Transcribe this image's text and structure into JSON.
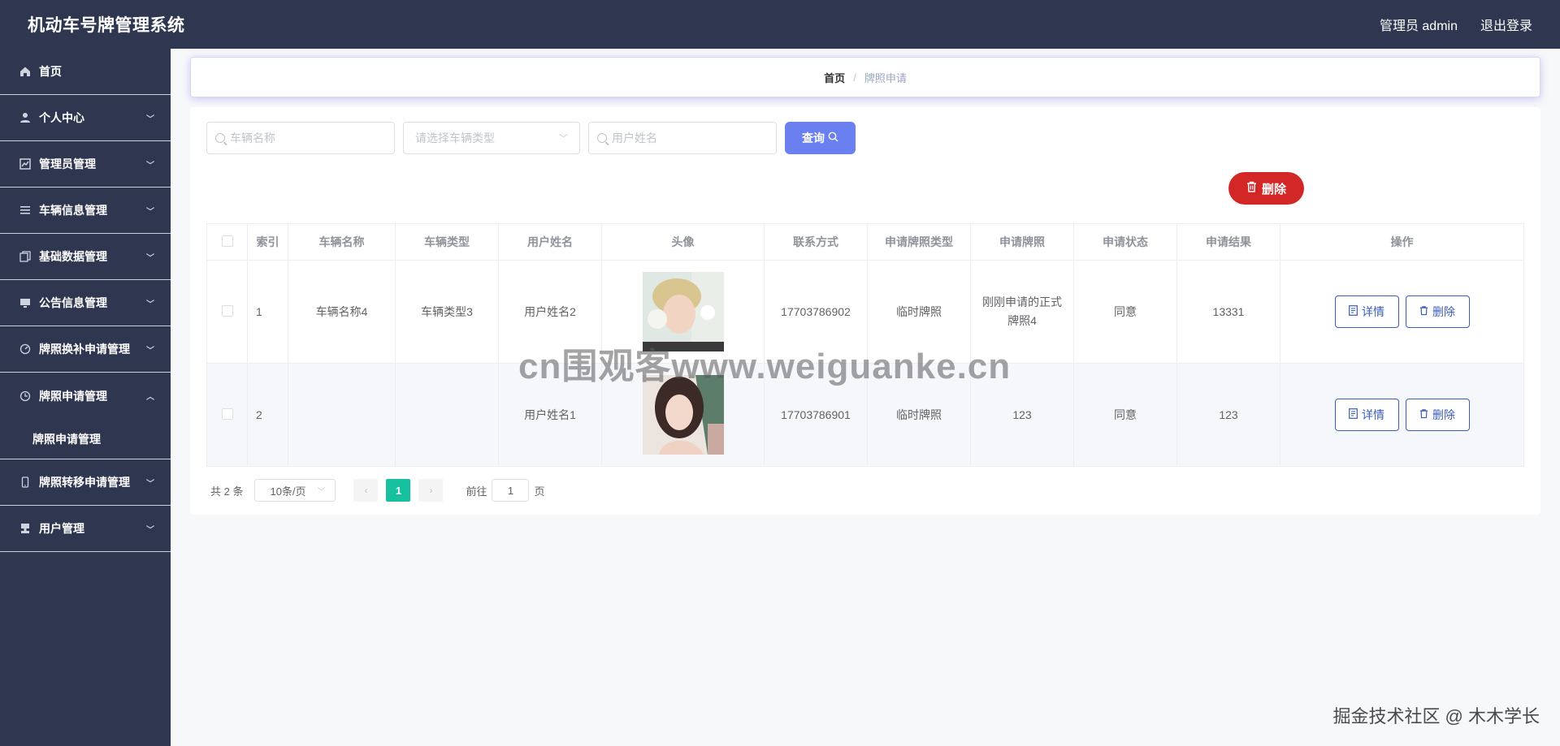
{
  "app": {
    "title": "机动车号牌管理系统",
    "admin_label": "管理员 admin",
    "logout_label": "退出登录"
  },
  "sidebar": {
    "items": [
      {
        "label": "首页",
        "icon": "home-icon"
      },
      {
        "label": "个人中心",
        "icon": "user-icon"
      },
      {
        "label": "管理员管理",
        "icon": "chart-icon"
      },
      {
        "label": "车辆信息管理",
        "icon": "list-icon"
      },
      {
        "label": "基础数据管理",
        "icon": "copy-icon"
      },
      {
        "label": "公告信息管理",
        "icon": "monitor-icon"
      },
      {
        "label": "牌照换补申请管理",
        "icon": "gauge-icon"
      },
      {
        "label": "牌照申请管理",
        "icon": "clock-icon"
      },
      {
        "label": "牌照转移申请管理",
        "icon": "phone-icon"
      },
      {
        "label": "用户管理",
        "icon": "stamp-icon"
      }
    ],
    "sub_item": "牌照申请管理"
  },
  "breadcrumb": {
    "home": "首页",
    "separator": "/",
    "current": "牌照申请"
  },
  "search": {
    "vehicle_name_placeholder": "车辆名称",
    "vehicle_type_placeholder": "请选择车辆类型",
    "user_name_placeholder": "用户姓名",
    "query_label": "查询"
  },
  "toolbar": {
    "delete_label": "删除"
  },
  "table": {
    "headers": [
      "索引",
      "车辆名称",
      "车辆类型",
      "用户姓名",
      "头像",
      "联系方式",
      "申请牌照类型",
      "申请牌照",
      "申请状态",
      "申请结果",
      "操作"
    ],
    "rows": [
      {
        "index": "1",
        "vehicle_name": "车辆名称4",
        "vehicle_type": "车辆类型3",
        "user_name": "用户姓名2",
        "phone": "17703786902",
        "plate_type": "临时牌照",
        "plate": "刚刚申请的正式牌照4",
        "status": "同意",
        "result": "13331"
      },
      {
        "index": "2",
        "vehicle_name": "",
        "vehicle_type": "",
        "user_name": "用户姓名1",
        "phone": "17703786901",
        "plate_type": "临时牌照",
        "plate": "123",
        "status": "同意",
        "result": "123"
      }
    ],
    "detail_label": "详情",
    "delete_label": "删除"
  },
  "pagination": {
    "total": "共 2 条",
    "page_size": "10条/页",
    "current_page": "1",
    "goto_prefix": "前往",
    "goto_value": "1",
    "goto_suffix": "页"
  },
  "watermarks": {
    "center": "cn围观客www.weiguanke.cn",
    "footer": "掘金技术社区 @ 木木学长"
  }
}
